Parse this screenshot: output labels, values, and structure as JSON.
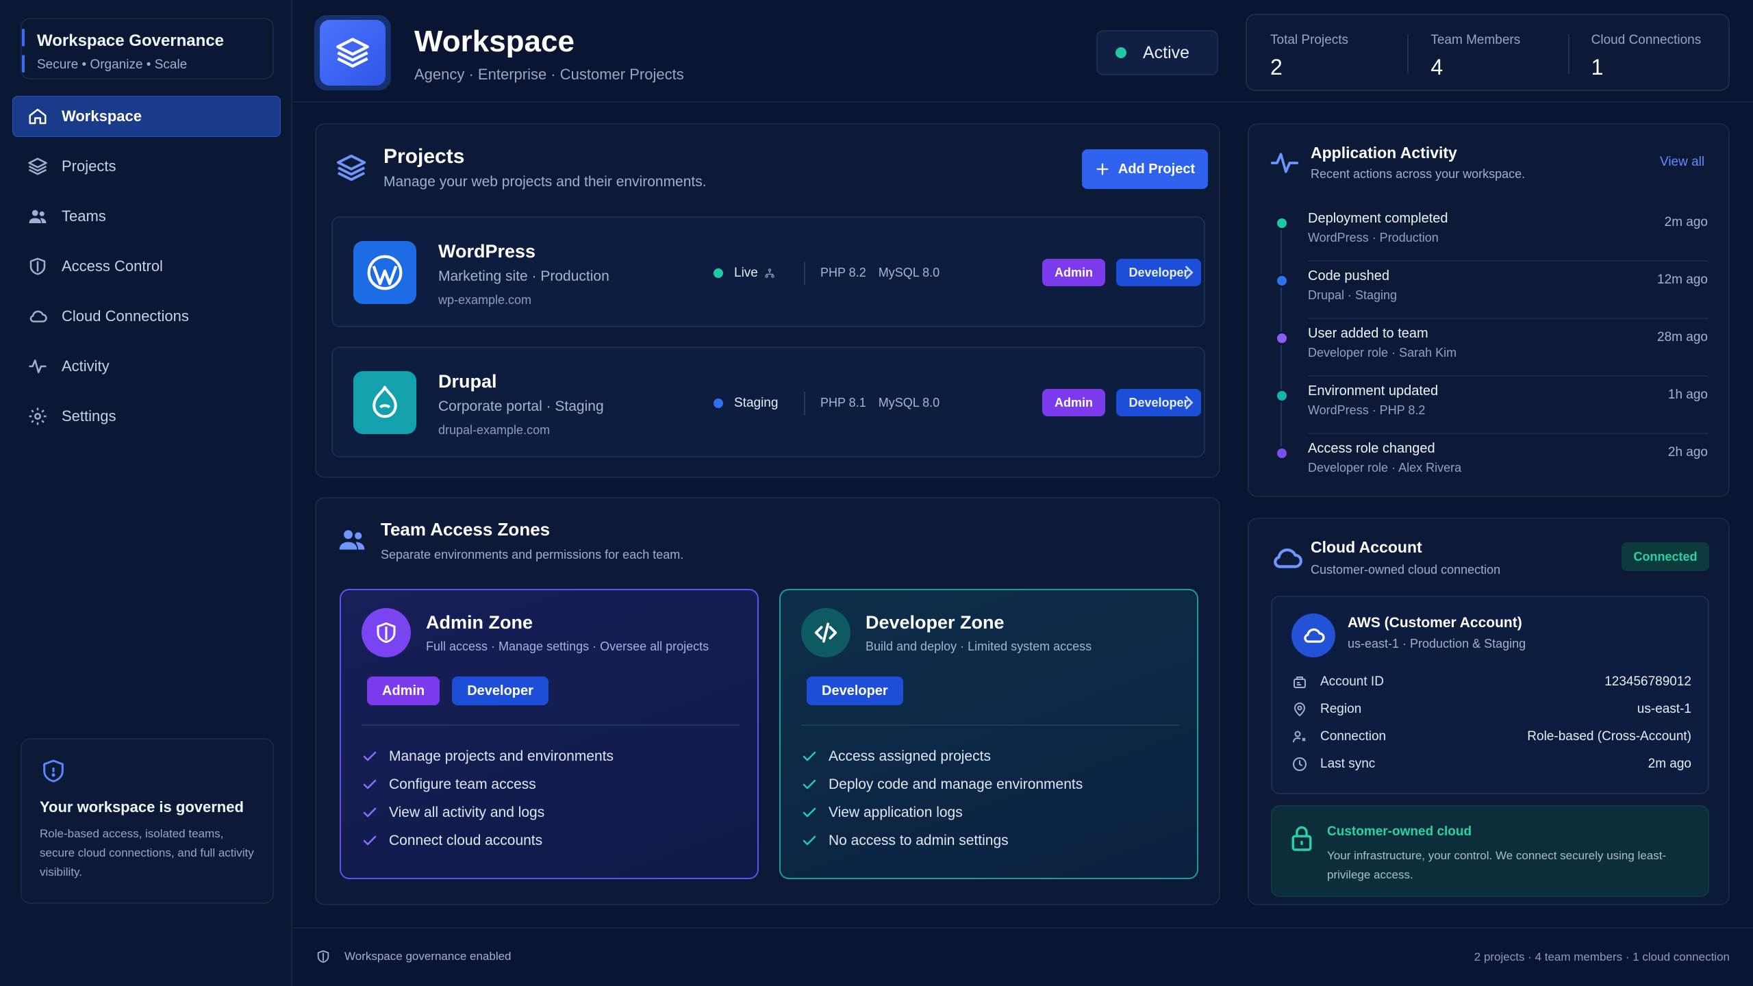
{
  "brand": {
    "title": "Workspace Governance",
    "subtitle": "Secure • Organize • Scale"
  },
  "nav": {
    "items": [
      {
        "label": "Workspace",
        "icon": "home-icon"
      },
      {
        "label": "Projects",
        "icon": "layers-icon"
      },
      {
        "label": "Teams",
        "icon": "users-icon"
      },
      {
        "label": "Access Control",
        "icon": "shield-icon"
      },
      {
        "label": "Cloud Connections",
        "icon": "cloud-icon"
      },
      {
        "label": "Activity",
        "icon": "pulse-icon"
      },
      {
        "label": "Settings",
        "icon": "gear-icon"
      }
    ]
  },
  "governance_card": {
    "title": "Your workspace is governed",
    "text": "Role-based access, isolated teams, secure cloud connections, and full activity visibility."
  },
  "header": {
    "title": "Workspace",
    "subtitle": "Agency · Enterprise · Customer Projects",
    "status": "Active",
    "stats": [
      {
        "label": "Total Projects",
        "value": "2"
      },
      {
        "label": "Team Members",
        "value": "4"
      },
      {
        "label": "Cloud Connections",
        "value": "1"
      }
    ]
  },
  "projects": {
    "title": "Projects",
    "subtitle": "Manage your web projects and their environments.",
    "add_label": "Add Project",
    "items": [
      {
        "name": "WordPress",
        "desc": "Marketing site · Production",
        "url": "wp-example.com",
        "status": "Live",
        "php": "PHP 8.2",
        "db": "MySQL 8.0",
        "badge_admin": "Admin",
        "badge_dev": "Developer"
      },
      {
        "name": "Drupal",
        "desc": "Corporate portal · Staging",
        "url": "drupal-example.com",
        "status": "Staging",
        "php": "PHP 8.1",
        "db": "MySQL 8.0",
        "badge_admin": "Admin",
        "badge_dev": "Developer"
      }
    ]
  },
  "zones": {
    "title": "Team Access Zones",
    "subtitle": "Separate environments and permissions for each team.",
    "admin": {
      "title": "Admin Zone",
      "subtitle": "Full access · Manage settings · Oversee all projects",
      "badges": [
        "Admin",
        "Developer"
      ],
      "perms": [
        "Manage projects and environments",
        "Configure team access",
        "View all activity and logs",
        "Connect cloud accounts"
      ]
    },
    "developer": {
      "title": "Developer Zone",
      "subtitle": "Build and deploy · Limited system access",
      "badges": [
        "Developer"
      ],
      "perms": [
        "Access assigned projects",
        "Deploy code and manage environments",
        "View application logs",
        "No access to admin settings"
      ]
    }
  },
  "activity": {
    "title": "Application Activity",
    "subtitle": "Recent actions across your workspace.",
    "view_all": "View all",
    "items": [
      {
        "title": "Deployment completed",
        "sub": "WordPress · Production",
        "time": "2m ago",
        "color": "#1fc9a3"
      },
      {
        "title": "Code pushed",
        "sub": "Drupal · Staging",
        "time": "12m ago",
        "color": "#2f6ff0"
      },
      {
        "title": "User added to team",
        "sub": "Developer role · Sarah Kim",
        "time": "28m ago",
        "color": "#8b5cf6"
      },
      {
        "title": "Environment updated",
        "sub": "WordPress · PHP 8.2",
        "time": "1h ago",
        "color": "#17b3b0"
      },
      {
        "title": "Access role changed",
        "sub": "Developer role · Alex Rivera",
        "time": "2h ago",
        "color": "#7c4df0"
      }
    ]
  },
  "cloud": {
    "title": "Cloud Account",
    "subtitle": "Customer-owned cloud connection",
    "status": "Connected",
    "account_title": "AWS (Customer Account)",
    "account_sub": "us-east-1 · Production & Staging",
    "rows": [
      {
        "label": "Account ID",
        "value": "123456789012",
        "icon": "id-icon"
      },
      {
        "label": "Region",
        "value": "us-east-1",
        "icon": "location-icon"
      },
      {
        "label": "Connection",
        "value": "Role-based (Cross-Account)",
        "icon": "connection-icon"
      },
      {
        "label": "Last sync",
        "value": "2m ago",
        "icon": "clock-icon"
      }
    ],
    "secure_title": "Customer-owned cloud",
    "secure_text": "Your infrastructure, your control. We connect securely using least-privilege access."
  },
  "footer": {
    "left": "Workspace governance enabled",
    "right": "2 projects  ·  4 team members  ·  1 cloud connection"
  },
  "colors": {
    "accent": "#2f63ef",
    "success": "#1fc9a3",
    "admin": "#7c3aed",
    "developer": "#1d4ed8"
  }
}
